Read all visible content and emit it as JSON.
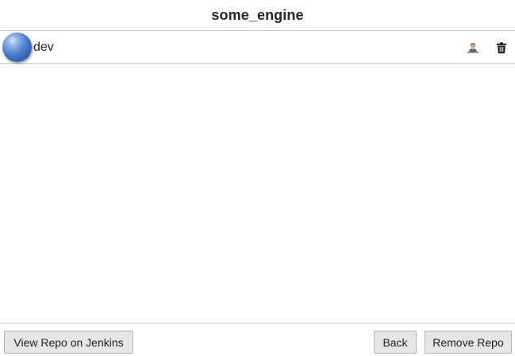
{
  "window": {
    "title": "some_engine"
  },
  "repo_list": {
    "rows": [
      {
        "label": "dev",
        "status_icon": "blue-ball-icon",
        "status_color": "#4d7fcc",
        "actions": [
          {
            "icon": "person-icon"
          },
          {
            "icon": "trash-icon"
          }
        ]
      }
    ]
  },
  "footer": {
    "view_on_jenkins_label": "View Repo on Jenkins",
    "back_label": "Back",
    "remove_repo_label": "Remove Repo"
  }
}
